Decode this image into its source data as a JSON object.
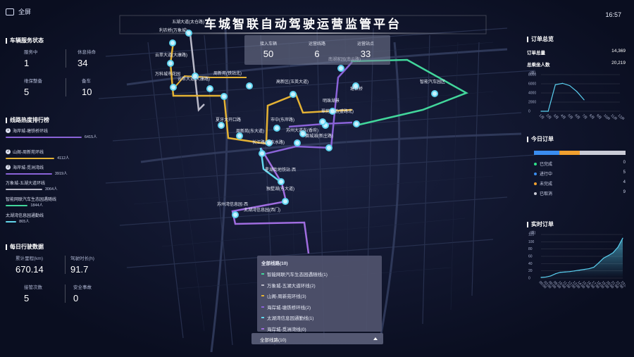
{
  "header": {
    "fullscreen_label": "全屏",
    "title": "车城智联自动驾驶运营监管平台",
    "time": "16:57"
  },
  "vehicle_status": {
    "title": "车辆服务状态",
    "in_service_label": "服务中",
    "in_service_value": "1",
    "idle_label": "休息待命",
    "idle_value": "34",
    "maintenance_label": "维保整备",
    "maintenance_value": "5",
    "standby_label": "备车",
    "standby_value": "10"
  },
  "route_ranking": {
    "title": "线路热度排行榜",
    "items": [
      {
        "rank": "1",
        "name": "海岸城-塘铁桥环线",
        "value": "6415人",
        "color": "#8a63d8",
        "ratio": 1.0
      },
      {
        "rank": "2",
        "name": "山阁-周新苑环线",
        "value": "4112人",
        "color": "#e4b234",
        "ratio": 0.64
      },
      {
        "rank": "3",
        "name": "海岸城-觅洲湾线",
        "value": "3919人",
        "color": "#8a63d8",
        "ratio": 0.61
      },
      {
        "rank": "",
        "name": "万象城-五湖大道环线",
        "value": "3064人",
        "color": "#b9b9c8",
        "ratio": 0.48
      },
      {
        "rank": "",
        "name": "智能网联汽车生态园遇随线",
        "value": "1844人",
        "color": "#42d69b",
        "ratio": 0.29
      },
      {
        "rank": "",
        "name": "太湖湾信息园通勤线",
        "value": "865人",
        "color": "#63d6ec",
        "ratio": 0.14
      }
    ]
  },
  "daily_driving": {
    "title": "每日行驶数据",
    "mileage_label": "累计里程(km)",
    "mileage_value": "670.14",
    "duration_label": "驾驶时长(h)",
    "duration_value": "91.7",
    "takeover_label": "接管次数",
    "takeover_value": "5",
    "accident_label": "安全事故",
    "accident_value": "0"
  },
  "kpis": [
    {
      "label": "接入车辆",
      "value": "50"
    },
    {
      "label": "运营线路",
      "value": "6"
    },
    {
      "label": "运营站点",
      "value": "33"
    }
  ],
  "order_overview": {
    "title": "订单总览",
    "total_label": "订单总量",
    "total_value": "14,369",
    "passengers_label": "总乘坐人数",
    "passengers_value": "20,219"
  },
  "today_orders": {
    "title": "今日订单",
    "items": [
      {
        "label": "已完成",
        "value": "0",
        "color": "#2ee089"
      },
      {
        "label": "进行中",
        "value": "5",
        "color": "#3a8df0"
      },
      {
        "label": "未完成",
        "value": "4",
        "color": "#f0a030"
      },
      {
        "label": "已取消",
        "value": "9",
        "color": "#c9cbd6"
      }
    ]
  },
  "realtime_orders": {
    "title": "实时订单"
  },
  "map_labels": [
    "利农桥(万象城)",
    "五湖大道(太仓路)",
    "云萃大道(大康路)",
    "万科城市花园",
    "云萃大道(大康路)",
    "周新苑(铁站北)",
    "高新区(玉英大道)",
    "明珠湖景",
    "市中(东岸路)",
    "塘铁桥",
    "翠苑大道(盛路北)",
    "智能汽车园区",
    "南湖家园(南云路)",
    "夏牙大开口路",
    "周新苑(东大道)",
    "苏州大道东(香府)",
    "赛城湖(新庄路)",
    "长江路(乐东水路)",
    "星湖街地铁站·西",
    "独墅湖(东大道)",
    "苏州湾信息园·西",
    "太湖湾信息园(西门)"
  ],
  "route_filter": {
    "header": "全部线路(10)",
    "items": [
      {
        "label": "智能网联汽车生态园遇随线(1)",
        "color": "#42d69b"
      },
      {
        "label": "万象城-五湖大道环线(2)",
        "color": "#b9b9c8"
      },
      {
        "label": "山阁-周新苑环线(3)",
        "color": "#e4b234"
      },
      {
        "label": "海岸城-塘铁桥环线(2)",
        "color": "#8a63d8"
      },
      {
        "label": "太湖湾信息园通勤线(1)",
        "color": "#63d6ec"
      },
      {
        "label": "海岸城-觅洲湾线(0)",
        "color": "#a06de0"
      }
    ],
    "selected": "全部线路(10)"
  },
  "chart_data": [
    {
      "type": "line",
      "title": "订单总览",
      "x": [
        "1月",
        "2月",
        "3月",
        "4月",
        "5月",
        "6月",
        "7月",
        "8月",
        "9月",
        "10月",
        "11月",
        "12月"
      ],
      "ylabel": "(单)",
      "yticks": [
        "0",
        "2000",
        "4000",
        "6000",
        "8000"
      ],
      "ylim": [
        0,
        8000
      ],
      "series": [
        {
          "values": [
            0,
            0,
            5800,
            6100,
            5600,
            4300,
            2500
          ]
        }
      ],
      "grid": true
    },
    {
      "type": "bar",
      "title": "今日订单",
      "categories": [
        "已完成",
        "进行中",
        "未完成",
        "已取消"
      ],
      "values": [
        0,
        5,
        4,
        9
      ]
    },
    {
      "type": "area",
      "title": "实时订单",
      "ylabel": "(单)",
      "yticks": [
        "0",
        "20",
        "40",
        "60",
        "80",
        "100",
        "120"
      ],
      "x": [
        "00:00",
        "03:00",
        "06:00",
        "09:00",
        "10:00",
        "11:00",
        "12:00",
        "13:00",
        "14:00",
        "15:00",
        "16:00",
        "17:00",
        "18:00",
        "19:00",
        "20:00",
        "21:00",
        "22:00",
        "23:00"
      ],
      "ylim": [
        0,
        120
      ],
      "series": [
        {
          "values": [
            2,
            3,
            6,
            12,
            16,
            17,
            18,
            20,
            22,
            24,
            26,
            30,
            42,
            55,
            62,
            70,
            85,
            110
          ]
        }
      ],
      "grid": true
    }
  ]
}
